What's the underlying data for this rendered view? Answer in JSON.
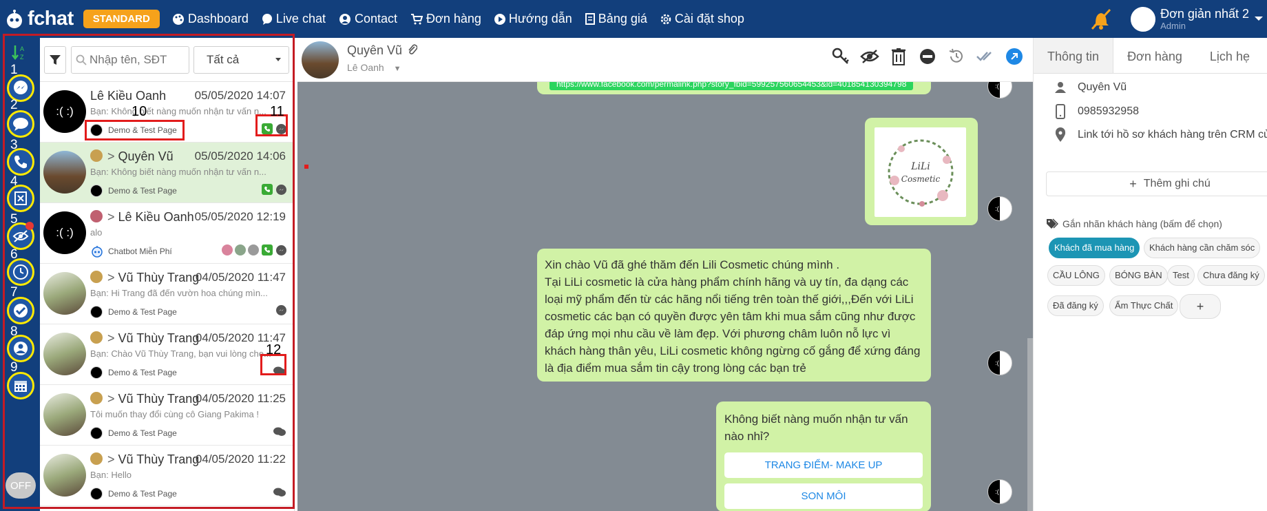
{
  "topbar": {
    "logo": "fchat",
    "plan": "STANDARD",
    "nav": [
      {
        "label": "Dashboard",
        "icon": "palette-icon"
      },
      {
        "label": "Live chat",
        "icon": "chat-bubble-icon"
      },
      {
        "label": "Contact",
        "icon": "contact-icon"
      },
      {
        "label": "Đơn hàng",
        "icon": "cart-icon"
      },
      {
        "label": "Hướng dẫn",
        "icon": "play-icon"
      },
      {
        "label": "Bảng giá",
        "icon": "document-icon"
      },
      {
        "label": "Cài đặt shop",
        "icon": "gear-icon"
      }
    ],
    "user_name": "Đơn giản nhất 2",
    "user_role": "Admin"
  },
  "rail": {
    "numbers": [
      "1",
      "2",
      "3",
      "4",
      "5",
      "6",
      "7",
      "8",
      "9"
    ],
    "off_label": "OFF"
  },
  "filters": {
    "search_placeholder": "Nhập tên, SĐT",
    "select_value": "Tất cả"
  },
  "conversations": [
    {
      "name": "Lê Kiều Oanh",
      "time": "05/05/2020 14:07",
      "preview": "Bạn: Không biết nàng muốn nhận tư vấn n...",
      "page": "Demo & Test Page",
      "avatar": ":(  :)"
    },
    {
      "name": "Quyên Vũ",
      "time": "05/05/2020 14:06",
      "preview": "Bạn: Không biết nàng muốn nhận tư vấn n...",
      "page": "Demo & Test Page",
      "avatar": ""
    },
    {
      "name": "Lê Kiều Oanh",
      "time": "05/05/2020 12:19",
      "preview": "alo",
      "page": "Chatbot Miễn Phí",
      "avatar": ":(  :)"
    },
    {
      "name": "Vũ Thùy Trang",
      "time": "04/05/2020 11:47",
      "preview": "Bạn: Hi Trang đã đến vườn hoa chúng mìn...",
      "page": "Demo & Test Page",
      "avatar": ""
    },
    {
      "name": "Vũ Thùy Trang",
      "time": "04/05/2020 11:47",
      "preview": "Bạn: Chào Vũ Thùy Trang, bạn vui lòng che...",
      "page": "Demo & Test Page",
      "avatar": ""
    },
    {
      "name": "Vũ Thùy Trang",
      "time": "04/05/2020 11:25",
      "preview": "Tôi muốn thay đổi cùng cô Giang Pakima !",
      "page": "Demo & Test Page",
      "avatar": ""
    },
    {
      "name": "Vũ Thùy Trang",
      "time": "04/05/2020 11:22",
      "preview": "Bạn: Hello",
      "page": "Demo & Test Page",
      "avatar": ""
    }
  ],
  "annotations": {
    "n10": "10",
    "n11": "11",
    "n12": "12"
  },
  "chat_header": {
    "name": "Quyên Vũ",
    "assignee": "Lê Oanh"
  },
  "messages": {
    "link": "https://www.facebook.com/permalink.php?story_fbid=599257560654453&id=401854130394798",
    "logo_line1": "LiLi",
    "logo_line2": "Cosmetic",
    "welcome": "Xin chào Vũ đã ghé thăm đến Lili Cosmetic chúng mình .\nTại LiLi cosmetic là cửa hàng phẩm chính hãng và uy tín, đa dạng các loại mỹ phẩm đến từ các hãng nổi tiếng trên toàn thế giới,,,Đến với LiLi cosmetic các bạn có quyền được yên tâm khi mua sắm cũng như được đáp ứng mọi nhu cầu về làm đẹp. Với phương châm luôn nỗ lực vì khách hàng thân yêu, LiLi cosmetic không ngừng cố gắng để xứng đáng là địa điểm mua sắm tin cậy trong lòng các bạn trẻ",
    "question": "Không biết nàng muốn nhận tư vấn nào nhỉ?",
    "option1": "TRANG ĐIỂM- MAKE UP",
    "option2": "SON MÔI",
    "bot_avatar_text": ":(  :)"
  },
  "info_panel": {
    "tabs": [
      "Thông tin",
      "Đơn hàng",
      "Lịch hẹ"
    ],
    "name": "Quyên Vũ",
    "phone": "0985932958",
    "crm_link": "Link tới hồ sơ khách hàng trên CRM của",
    "add_note": "Thêm ghi chú",
    "tag_title": "Gắn nhãn khách hàng (bấm để chọn)",
    "tags": [
      "Khách đã mua hàng",
      "Khách hàng cần chăm sóc",
      "CẦU LÔNG",
      "BÓNG BÀN",
      "Test",
      "Chưa đăng ký",
      "Đã đăng ký",
      "Ẩm Thực Chất",
      "+"
    ]
  },
  "colors": {
    "topbar": "#123f7c",
    "accent": "#f6a21b",
    "bubble": "#d1f2a6",
    "chat_bg": "#838b93",
    "selected_tag": "#1c95b4",
    "annotation_red": "#e21c1c",
    "annotation_yellow": "#ffea00"
  }
}
